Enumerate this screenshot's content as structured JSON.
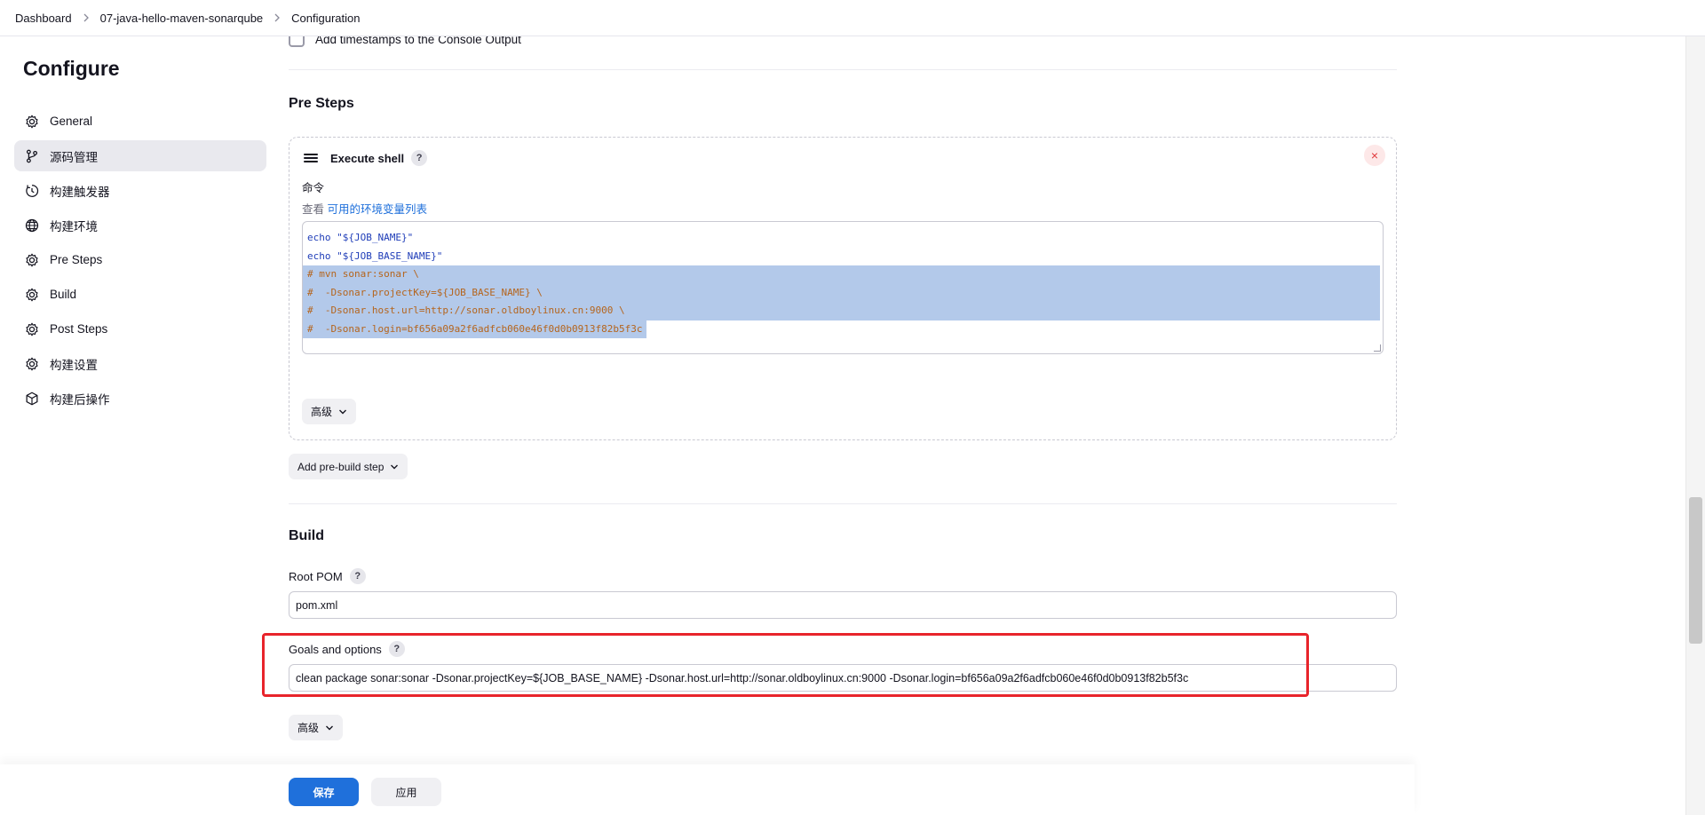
{
  "breadcrumb": {
    "items": [
      "Dashboard",
      "07-java-hello-maven-sonarqube",
      "Configuration"
    ]
  },
  "sidebar": {
    "title": "Configure",
    "items": [
      {
        "label": "General",
        "icon": "gear-icon",
        "active": false
      },
      {
        "label": "源码管理",
        "icon": "branch-icon",
        "active": true
      },
      {
        "label": "构建触发器",
        "icon": "clock-icon",
        "active": false
      },
      {
        "label": "构建环境",
        "icon": "globe-icon",
        "active": false
      },
      {
        "label": "Pre Steps",
        "icon": "gear-icon",
        "active": false
      },
      {
        "label": "Build",
        "icon": "gear-icon",
        "active": false
      },
      {
        "label": "Post Steps",
        "icon": "gear-icon",
        "active": false
      },
      {
        "label": "构建设置",
        "icon": "gear-icon",
        "active": false
      },
      {
        "label": "构建后操作",
        "icon": "cube-icon",
        "active": false
      }
    ]
  },
  "main": {
    "timestamps_label": "Add timestamps to the Console Output",
    "pre_steps": {
      "title": "Pre Steps",
      "step_name": "Execute shell",
      "help": "?",
      "close": "×",
      "command_label": "命令",
      "env_prefix": "查看",
      "env_link": "可用的环境变量列表",
      "code": [
        "echo \"${JOB_NAME}\"",
        "echo \"${JOB_BASE_NAME}\"",
        "# mvn sonar:sonar \\",
        "#  -Dsonar.projectKey=${JOB_BASE_NAME} \\",
        "#  -Dsonar.host.url=http://sonar.oldboylinux.cn:9000 \\",
        "#  -Dsonar.login=bf656a09a2f6adfcb060e46f0d0b0913f82b5f3c"
      ],
      "advanced_label": "高级",
      "add_step_label": "Add pre-build step"
    },
    "build": {
      "title": "Build",
      "root_pom_label": "Root POM",
      "root_pom_value": "pom.xml",
      "goals_label": "Goals and options",
      "goals_value": "clean package sonar:sonar -Dsonar.projectKey=${JOB_BASE_NAME} -Dsonar.host.url=http://sonar.oldboylinux.cn:9000 -Dsonar.login=bf656a09a2f6adfcb060e46f0d0b0913f82b5f3c",
      "advanced_label": "高级"
    }
  },
  "footer": {
    "save_label": "保存",
    "apply_label": "应用"
  },
  "colors": {
    "accent": "#1f70db",
    "highlight": "#e8242b",
    "selection": "#b3c9ea"
  }
}
